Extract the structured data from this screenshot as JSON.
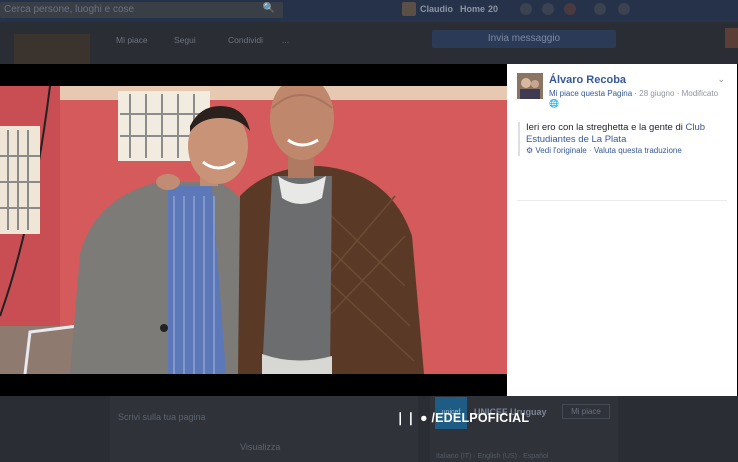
{
  "background": {
    "search_placeholder": "Cerca persone, luoghi e cose",
    "nav_user": "Claudio",
    "nav_home": "Home",
    "nav_home_count": "20",
    "actions": {
      "like": "Mi piace",
      "follow": "Segui",
      "share": "Condividi",
      "more": "..."
    },
    "message_button": "Invia messaggio",
    "lower_text_1": "Scrivi sulla tua pagina",
    "lower_text_2": "Visualizza",
    "unicef": {
      "name": "UNICEF Uruguay",
      "like_label": "Mi piace",
      "sub": "Italiano (IT) · English (US) · Español"
    }
  },
  "photo": {
    "watermark": "/EDELPOFICIAL",
    "colors": {
      "wall": "#d9595b",
      "trim": "#f0e8dc"
    }
  },
  "panel": {
    "author": "Álvaro Recoba",
    "like_page": "Mi piace questa Pagina",
    "date": "28 giugno",
    "edited": "Modificato",
    "post_text_prefix": "Ieri ero con la streghetta e la gente di ",
    "post_link": "Club Estudiantes de La Plata",
    "see_original": "Vedi l'originale",
    "translate": "Valuta questa traduzione",
    "colors": {
      "link": "#365899",
      "meta": "#90949c"
    }
  }
}
